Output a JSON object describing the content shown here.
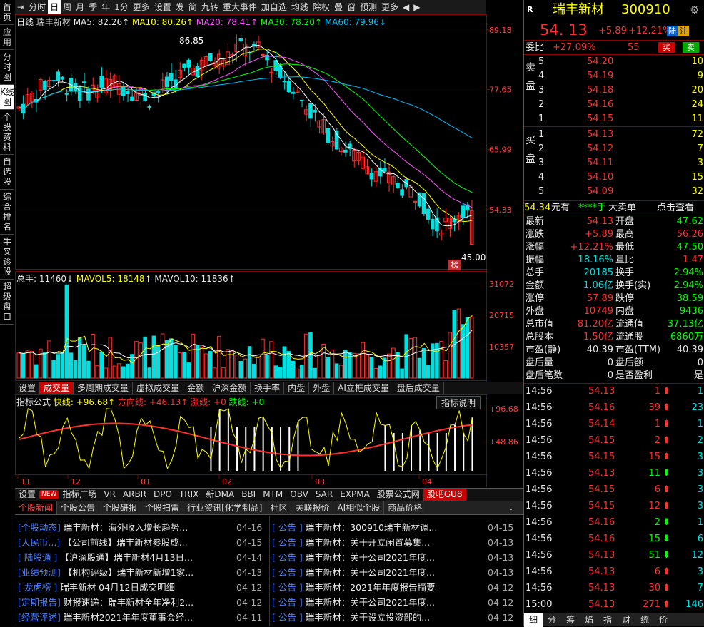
{
  "leftbar": [
    "首页",
    "应用",
    "分时图",
    "K线图",
    "个股资料",
    "自选股",
    "综合排名",
    "牛叉诊股",
    "超级盘口"
  ],
  "toolbar": [
    "分时",
    "日",
    "周",
    "月",
    "季",
    "年",
    "1分",
    "更多",
    "设置",
    "发",
    "简",
    "九转",
    "重大事件",
    "加自选",
    "均线",
    "除权",
    "叠",
    "窗",
    "预测",
    "更多"
  ],
  "main": {
    "legend": {
      "period": "日线",
      "name": "瑞丰新材",
      "ma5": "MA5: 82.26↑",
      "ma10": "MA10: 80.26↑",
      "ma20": "MA20: 78.41↑",
      "ma30": "MA30: 78.20↑",
      "ma60": "MA60: 79.96↓"
    },
    "price_axis": [
      "89.18",
      "77.65",
      "65.99",
      "54.33"
    ],
    "high_label": "86.85",
    "low_label": "45.00",
    "bang": "榜",
    "vol_legend": {
      "total": "总手: 11460↓",
      "mavol5": "MAVOL5: 18148↑",
      "mavol10": "MAVOL10: 11836↑"
    },
    "vol_axis": [
      "31072",
      "20715",
      "10357"
    ]
  },
  "colors": {
    "ma5": "#ffffff",
    "ma10": "#ffff00",
    "ma20": "#ff50ff",
    "ma30": "#00ff00",
    "ma60": "#00c0ff",
    "up": "#ff3030",
    "down": "#00e0e0"
  },
  "subtabs": [
    "设置",
    "成交量",
    "多周期成交量",
    "虚拟成交量",
    "金额",
    "沪深金额",
    "换手率",
    "内盘",
    "外盘",
    "AI立桩成交量",
    "盘后成交量"
  ],
  "indic": {
    "name": "指标公式",
    "fast": "快线: +96.68↑",
    "dir": "方向线: +46.13↑",
    "rise": "涨线: +0",
    "fall": "跌线: +0",
    "btn": "指标说明",
    "axis": [
      "+96.68",
      "+48.86"
    ],
    "months": [
      "11",
      "12",
      "01",
      "02",
      "03",
      "04"
    ]
  },
  "bottabs": [
    "设置",
    "NEW",
    "指标广场",
    "VR",
    "ARBR",
    "DPO",
    "TRIX",
    "新DMA",
    "BBI",
    "MTM",
    "OBV",
    "SAR",
    "EXPMA",
    "股票公式网",
    "股吧GU8"
  ],
  "newstabs": [
    "个股新闻",
    "个股公告",
    "个股研报",
    "个股扫雷",
    "行业资讯[化学制品]",
    "社区",
    "关联报价",
    "AI相似个股",
    "商品价格"
  ],
  "news_left": [
    {
      "cat": "[个股动态]",
      "title": "瑞丰新材：海外收入增长趋势...",
      "date": "04-16"
    },
    {
      "cat": "[人民币...]",
      "title": "【公司前线】瑞丰新材参股成...",
      "date": "04-15"
    },
    {
      "cat": "[ 陆股通 ]",
      "title": "【沪深股通】瑞丰新材4月13日...",
      "date": "04-14"
    },
    {
      "cat": "[业绩预测]",
      "title": "【机构评级】瑞丰新材新增1家...",
      "date": "04-13"
    },
    {
      "cat": "[ 龙虎榜 ]",
      "title": "瑞丰新材 04月12日成交明细",
      "date": "04-12"
    },
    {
      "cat": "[定期报告]",
      "title": "财报速递：瑞丰新材全年净利2...",
      "date": "04-12"
    },
    {
      "cat": "[经营评述]",
      "title": "瑞丰新材2021年年度董事会经...",
      "date": "04-11"
    }
  ],
  "news_right": [
    {
      "cat": "[  公告  ]",
      "title": "瑞丰新材：300910瑞丰新材调...",
      "date": "04-15"
    },
    {
      "cat": "[  公告  ]",
      "title": "瑞丰新材：关于开立闲置募集...",
      "date": "04-13"
    },
    {
      "cat": "[  公告  ]",
      "title": "瑞丰新材：关于公司2021年度...",
      "date": "04-13"
    },
    {
      "cat": "[  公告  ]",
      "title": "瑞丰新材：关于公司2021年度...",
      "date": "04-13"
    },
    {
      "cat": "[  公告  ]",
      "title": "瑞丰新材：2021年年度报告摘要",
      "date": "04-12"
    },
    {
      "cat": "[  公告  ]",
      "title": "瑞丰新材：关于公司2021年度...",
      "date": "04-12"
    },
    {
      "cat": "[  公告  ]",
      "title": "瑞丰新材：关于设立投资部的...",
      "date": "04-12"
    }
  ],
  "quote": {
    "badge": "R",
    "name": "瑞丰新材",
    "code": "300910",
    "price": "54. 13",
    "change": "+5.89",
    "pct": "+12.21%",
    "lu": "陆",
    "zhu": "注",
    "weibi_label": "委比",
    "weibi": "+27.09%",
    "weicha": "55",
    "buy_btn": "买",
    "sell_btn": "卖",
    "sell_side": "卖盘",
    "buy_side": "买盘",
    "asks": [
      [
        "5",
        "54.20",
        "10"
      ],
      [
        "4",
        "54.19",
        "9"
      ],
      [
        "3",
        "54.18",
        "20"
      ],
      [
        "2",
        "54.16",
        "24"
      ],
      [
        "1",
        "54.15",
        "11"
      ]
    ],
    "bids": [
      [
        "1",
        "54.13",
        "72"
      ],
      [
        "2",
        "54.12",
        "7"
      ],
      [
        "3",
        "54.11",
        "3"
      ],
      [
        "4",
        "54.10",
        "15"
      ],
      [
        "5",
        "54.09",
        "32"
      ]
    ],
    "dadan": {
      "price": "54.34",
      "unit": "元有",
      "hand": "****手",
      "label": "大卖单",
      "link": "点击查看"
    },
    "stats": [
      [
        "最新",
        "54.13",
        "开盘",
        "47.62"
      ],
      [
        "涨跌",
        "+5.89",
        "最高",
        "56.26"
      ],
      [
        "涨幅",
        "+12.21%",
        "最低",
        "47.50"
      ],
      [
        "振幅",
        "18.16%",
        "量比",
        "1.47"
      ],
      [
        "总手",
        "20185",
        "换手",
        "2.94%"
      ],
      [
        "金额",
        "1.06亿",
        "换手(实)",
        "2.94%"
      ],
      [
        "涨停",
        "57.89",
        "跌停",
        "38.59"
      ],
      [
        "外盘",
        "10749",
        "内盘",
        "9436"
      ],
      [
        "总市值",
        "81.20亿",
        "流通值",
        "37.13亿"
      ],
      [
        "总股本",
        "1.50亿",
        "流通股",
        "6860万"
      ],
      [
        "市盈(静)",
        "40.39",
        "市盈(TTM)",
        "40.39"
      ],
      [
        "盘后量",
        "0",
        "盘后额",
        "0"
      ],
      [
        "盘后笔数",
        "0",
        "是否盈利",
        "是"
      ]
    ],
    "ticks": [
      [
        "14:56",
        "54.13",
        "1",
        "up",
        "1"
      ],
      [
        "14:56",
        "54.16",
        "39",
        "up",
        "23"
      ],
      [
        "14:56",
        "54.14",
        "1",
        "up",
        "1"
      ],
      [
        "14:56",
        "54.15",
        "2",
        "up",
        "2"
      ],
      [
        "14:56",
        "54.15",
        "15",
        "up",
        "3"
      ],
      [
        "14:56",
        "54.13",
        "11",
        "dn",
        "3"
      ],
      [
        "14:56",
        "54.15",
        "6",
        "up",
        "3"
      ],
      [
        "14:56",
        "54.15",
        "12",
        "up",
        "3"
      ],
      [
        "14:56",
        "54.16",
        "2",
        "dn",
        "1"
      ],
      [
        "14:56",
        "54.16",
        "15",
        "dn",
        "6"
      ],
      [
        "14:56",
        "54.13",
        "51",
        "dn",
        "12"
      ],
      [
        "14:56",
        "54.13",
        "6",
        "up",
        "3"
      ],
      [
        "14:56",
        "54.13",
        "30",
        "up",
        "7"
      ],
      [
        "15:00",
        "54.13",
        "271",
        "up",
        "146"
      ]
    ],
    "tabs": [
      "细",
      "分",
      "筹",
      "焰",
      "指",
      "财",
      "统",
      "价"
    ]
  },
  "chart_data": {
    "type": "candlestick",
    "title": "瑞丰新材 日线",
    "price_axis": [
      54.33,
      65.99,
      77.65,
      89.18
    ],
    "high": 86.85,
    "low": 45.0,
    "ma": {
      "MA5": 82.26,
      "MA10": 80.26,
      "MA20": 78.41,
      "MA30": 78.2,
      "MA60": 79.96
    },
    "volume_axis": [
      10357,
      20715,
      31072
    ],
    "last_volume": 11460
  }
}
